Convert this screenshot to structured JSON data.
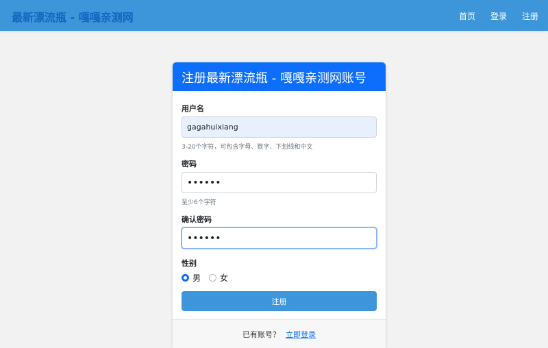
{
  "header": {
    "brand": "最新漂流瓶 - 嘎嘎亲测网",
    "nav": [
      "首页",
      "登录",
      "注册"
    ]
  },
  "card": {
    "title": "注册最新漂流瓶 - 嘎嘎亲测网账号",
    "username": {
      "label": "用户名",
      "value": "gagahuixiang",
      "help": "3-20个字符，可包含字母、数字、下划线和中文"
    },
    "password": {
      "label": "密码",
      "value": "••••••",
      "help": "至少6个字符"
    },
    "confirm": {
      "label": "确认密码",
      "value": "••••••"
    },
    "gender": {
      "label": "性别",
      "options": [
        "男",
        "女"
      ],
      "selected": "男"
    },
    "submit_label": "注册",
    "footer": {
      "text": "已有账号？",
      "link": "立即登录"
    }
  },
  "colors": {
    "navbar": "#3c96d9",
    "brand": "#1565c0",
    "card_header": "#0d6efd",
    "button": "#3c96d9"
  }
}
